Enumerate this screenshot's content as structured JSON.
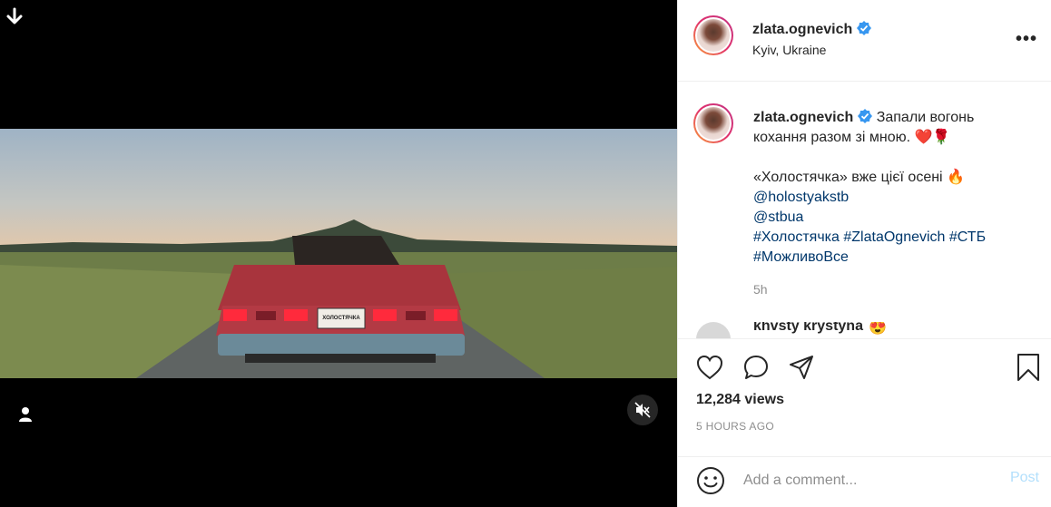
{
  "media": {
    "download_icon": "arrow-down-icon",
    "user_tag_icon": "user-icon",
    "mute_icon": "speaker-muted-icon",
    "plate_text": "ХОЛОСТЯЧКА"
  },
  "header": {
    "username": "zlata.ognevich",
    "location": "Kyiv, Ukraine",
    "more": "•••"
  },
  "caption": {
    "username": "zlata.ognevich",
    "line1": "Запали вогонь кохання разом зі мною. ❤️🌹",
    "line2": "«Холостячка» вже цієї осені 🔥",
    "mentions": [
      "@holostyakstb",
      "@stbua"
    ],
    "hashtags": "#Холостячка #ZlataOgnevich #СТБ",
    "hashtag2": "#МожливоВсе",
    "time": "5h"
  },
  "comment_peek": {
    "username": "khvsty krystyna",
    "emoji": "😍"
  },
  "actions": {
    "views": "12,284 views",
    "time_ago": "5 HOURS AGO"
  },
  "add_comment": {
    "placeholder": "Add a comment...",
    "post": "Post",
    "emoji_icon": "smiley-icon"
  },
  "colors": {
    "link": "#00376b",
    "verified": "#3897f0",
    "post_disabled": "#b2dffc",
    "muted_text": "#8e8e8e"
  }
}
